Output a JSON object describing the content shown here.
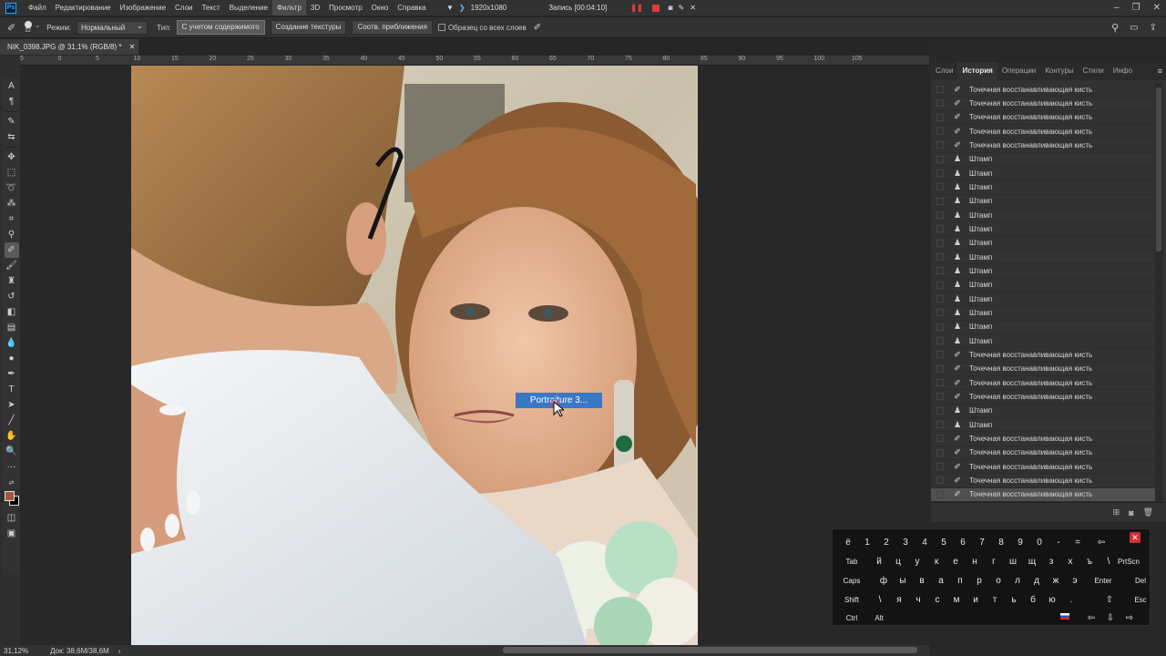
{
  "menubar": {
    "logo": "Ps",
    "items": [
      "Файл",
      "Редактирование",
      "Изображение",
      "Слои",
      "Текст",
      "Выделение",
      "Фильтр",
      "3D",
      "Просмотр",
      "Окно",
      "Справка"
    ],
    "active": "Фильтр"
  },
  "recorder": {
    "resolution": "1920x1080",
    "status": "Запись [00:04:10]"
  },
  "options": {
    "brush_size": "32",
    "mode_label": "Режим:",
    "mode_value": "Нормальный",
    "type_label": "Тип:",
    "type_content_aware": "С учетом содержимого",
    "type_create_texture": "Создание текстуры",
    "type_proximity_match": "Соотв. приближения",
    "sample_all_layers": "Образец со всех слоев"
  },
  "document": {
    "tab_title": "NIK_0398.JPG @ 31,1% (RGB/8) *"
  },
  "ruler": {
    "ticks": [
      "5",
      "0",
      "5",
      "10",
      "15",
      "20",
      "25",
      "30",
      "35",
      "40",
      "45",
      "50",
      "55",
      "60",
      "65",
      "70",
      "75",
      "80",
      "85",
      "90",
      "95",
      "100",
      "105"
    ]
  },
  "canvas": {
    "filter_tooltip": "Portraiture 3..."
  },
  "status": {
    "zoom": "31,12%",
    "doc_size": "Док: 38,6M/38,6M"
  },
  "panel": {
    "tabs": [
      "Слои",
      "История",
      "Операции",
      "Контуры",
      "Стили",
      "Инфо"
    ],
    "active_tab": "История",
    "history": [
      {
        "label": "Точечная восстанавливающая кисть",
        "icon": "healing-brush-icon"
      },
      {
        "label": "Точечная восстанавливающая кисть",
        "icon": "healing-brush-icon"
      },
      {
        "label": "Точечная восстанавливающая кисть",
        "icon": "healing-brush-icon"
      },
      {
        "label": "Точечная восстанавливающая кисть",
        "icon": "healing-brush-icon"
      },
      {
        "label": "Точечная восстанавливающая кисть",
        "icon": "healing-brush-icon"
      },
      {
        "label": "Штамп",
        "icon": "clone-stamp-icon"
      },
      {
        "label": "Штамп",
        "icon": "clone-stamp-icon"
      },
      {
        "label": "Штамп",
        "icon": "clone-stamp-icon"
      },
      {
        "label": "Штамп",
        "icon": "clone-stamp-icon"
      },
      {
        "label": "Штамп",
        "icon": "clone-stamp-icon"
      },
      {
        "label": "Штамп",
        "icon": "clone-stamp-icon"
      },
      {
        "label": "Штамп",
        "icon": "clone-stamp-icon"
      },
      {
        "label": "Штамп",
        "icon": "clone-stamp-icon"
      },
      {
        "label": "Штамп",
        "icon": "clone-stamp-icon"
      },
      {
        "label": "Штамп",
        "icon": "clone-stamp-icon"
      },
      {
        "label": "Штамп",
        "icon": "clone-stamp-icon"
      },
      {
        "label": "Штамп",
        "icon": "clone-stamp-icon"
      },
      {
        "label": "Штамп",
        "icon": "clone-stamp-icon"
      },
      {
        "label": "Штамп",
        "icon": "clone-stamp-icon"
      },
      {
        "label": "Точечная восстанавливающая кисть",
        "icon": "healing-brush-icon"
      },
      {
        "label": "Точечная восстанавливающая кисть",
        "icon": "healing-brush-icon"
      },
      {
        "label": "Точечная восстанавливающая кисть",
        "icon": "healing-brush-icon"
      },
      {
        "label": "Точечная восстанавливающая кисть",
        "icon": "healing-brush-icon"
      },
      {
        "label": "Штамп",
        "icon": "clone-stamp-icon"
      },
      {
        "label": "Штамп",
        "icon": "clone-stamp-icon"
      },
      {
        "label": "Точечная восстанавливающая кисть",
        "icon": "healing-brush-icon"
      },
      {
        "label": "Точечная восстанавливающая кисть",
        "icon": "healing-brush-icon"
      },
      {
        "label": "Точечная восстанавливающая кисть",
        "icon": "healing-brush-icon"
      },
      {
        "label": "Точечная восстанавливающая кисть",
        "icon": "healing-brush-icon"
      },
      {
        "label": "Точечная восстанавливающая кисть",
        "icon": "healing-brush-icon"
      }
    ]
  },
  "keyboard": {
    "rows": [
      [
        "ё",
        "1",
        "2",
        "3",
        "4",
        "5",
        "6",
        "7",
        "8",
        "9",
        "0",
        "-",
        "=",
        "⇦"
      ],
      [
        "Tab",
        "й",
        "ц",
        "у",
        "к",
        "е",
        "н",
        "г",
        "ш",
        "щ",
        "з",
        "х",
        "ъ",
        "\\",
        "PrtScn"
      ],
      [
        "Caps",
        "ф",
        "ы",
        "в",
        "а",
        "п",
        "р",
        "о",
        "л",
        "д",
        "ж",
        "э",
        "Enter",
        "Del"
      ],
      [
        "Shift",
        "\\",
        "я",
        "ч",
        "с",
        "м",
        "и",
        "т",
        "ь",
        "б",
        "ю",
        ".",
        "⇧",
        "Esc"
      ],
      [
        "Ctrl",
        "Alt",
        "⇦",
        "⇩",
        "⇨"
      ]
    ],
    "close": "✕"
  },
  "colors": {
    "foreground": "#a5573c",
    "background": "#000000",
    "accent": "#3b78c4"
  }
}
